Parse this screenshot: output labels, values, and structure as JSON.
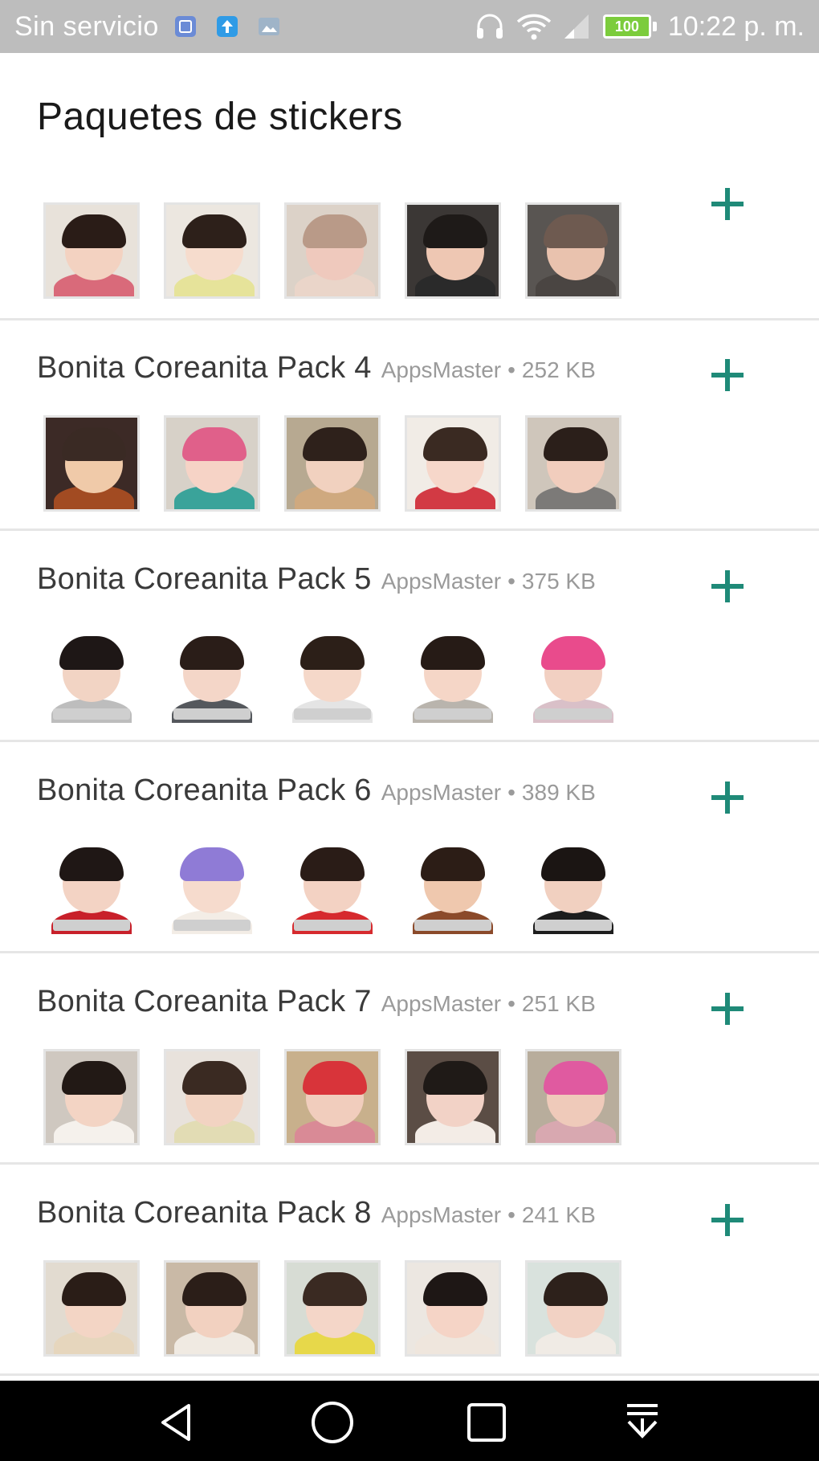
{
  "status_bar": {
    "carrier": "Sin servicio",
    "time": "10:22 p. m.",
    "battery": "100",
    "icons": [
      "notification-app-icon",
      "notification-upload-icon",
      "notification-photo-icon",
      "headset-icon",
      "wifi-icon",
      "signal-icon",
      "battery-icon"
    ]
  },
  "header": {
    "title": "Paquetes de stickers"
  },
  "packs": [
    {
      "name": "",
      "author": "",
      "size": "",
      "has_header": false
    },
    {
      "name": "Bonita Coreanita Pack 4",
      "author": "AppsMaster",
      "size": "252 KB",
      "has_header": true
    },
    {
      "name": "Bonita Coreanita Pack 5",
      "author": "AppsMaster",
      "size": "375 KB",
      "has_header": true
    },
    {
      "name": "Bonita Coreanita Pack 6",
      "author": "AppsMaster",
      "size": "389 KB",
      "has_header": true
    },
    {
      "name": "Bonita Coreanita Pack 7",
      "author": "AppsMaster",
      "size": "251 KB",
      "has_header": true
    },
    {
      "name": "Bonita Coreanita Pack 8",
      "author": "AppsMaster",
      "size": "241 KB",
      "has_header": true
    }
  ],
  "separator": "•",
  "add_icon": "plus-icon",
  "colors": {
    "accent": "#1f8a78",
    "status_bar": "#bdbdbd",
    "nav_bar": "#000000",
    "battery": "#7ccc3c"
  },
  "nav_bar": {
    "icons": [
      "back-icon",
      "home-icon",
      "recents-icon",
      "notifications-pull-icon"
    ]
  }
}
